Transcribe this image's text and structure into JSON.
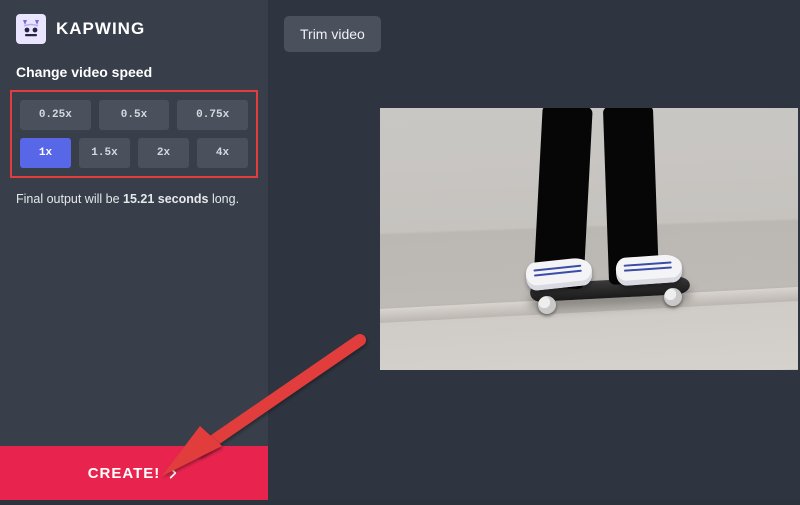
{
  "brand": {
    "name": "KAPWING"
  },
  "sidebar": {
    "section_title": "Change video speed",
    "speeds": [
      {
        "label": "0.25x",
        "selected": false
      },
      {
        "label": "0.5x",
        "selected": false
      },
      {
        "label": "0.75x",
        "selected": false
      },
      {
        "label": "1x",
        "selected": true
      },
      {
        "label": "1.5x",
        "selected": false
      },
      {
        "label": "2x",
        "selected": false
      },
      {
        "label": "4x",
        "selected": false
      }
    ],
    "output_prefix": "Final output will be ",
    "output_value": "15.21 seconds",
    "output_suffix": " long.",
    "create_label": "CREATE!"
  },
  "main": {
    "trim_label": "Trim video"
  },
  "annotation": {
    "highlight_target": "speed-selector",
    "arrow_target": "create-button",
    "color": "#e23c3c"
  }
}
